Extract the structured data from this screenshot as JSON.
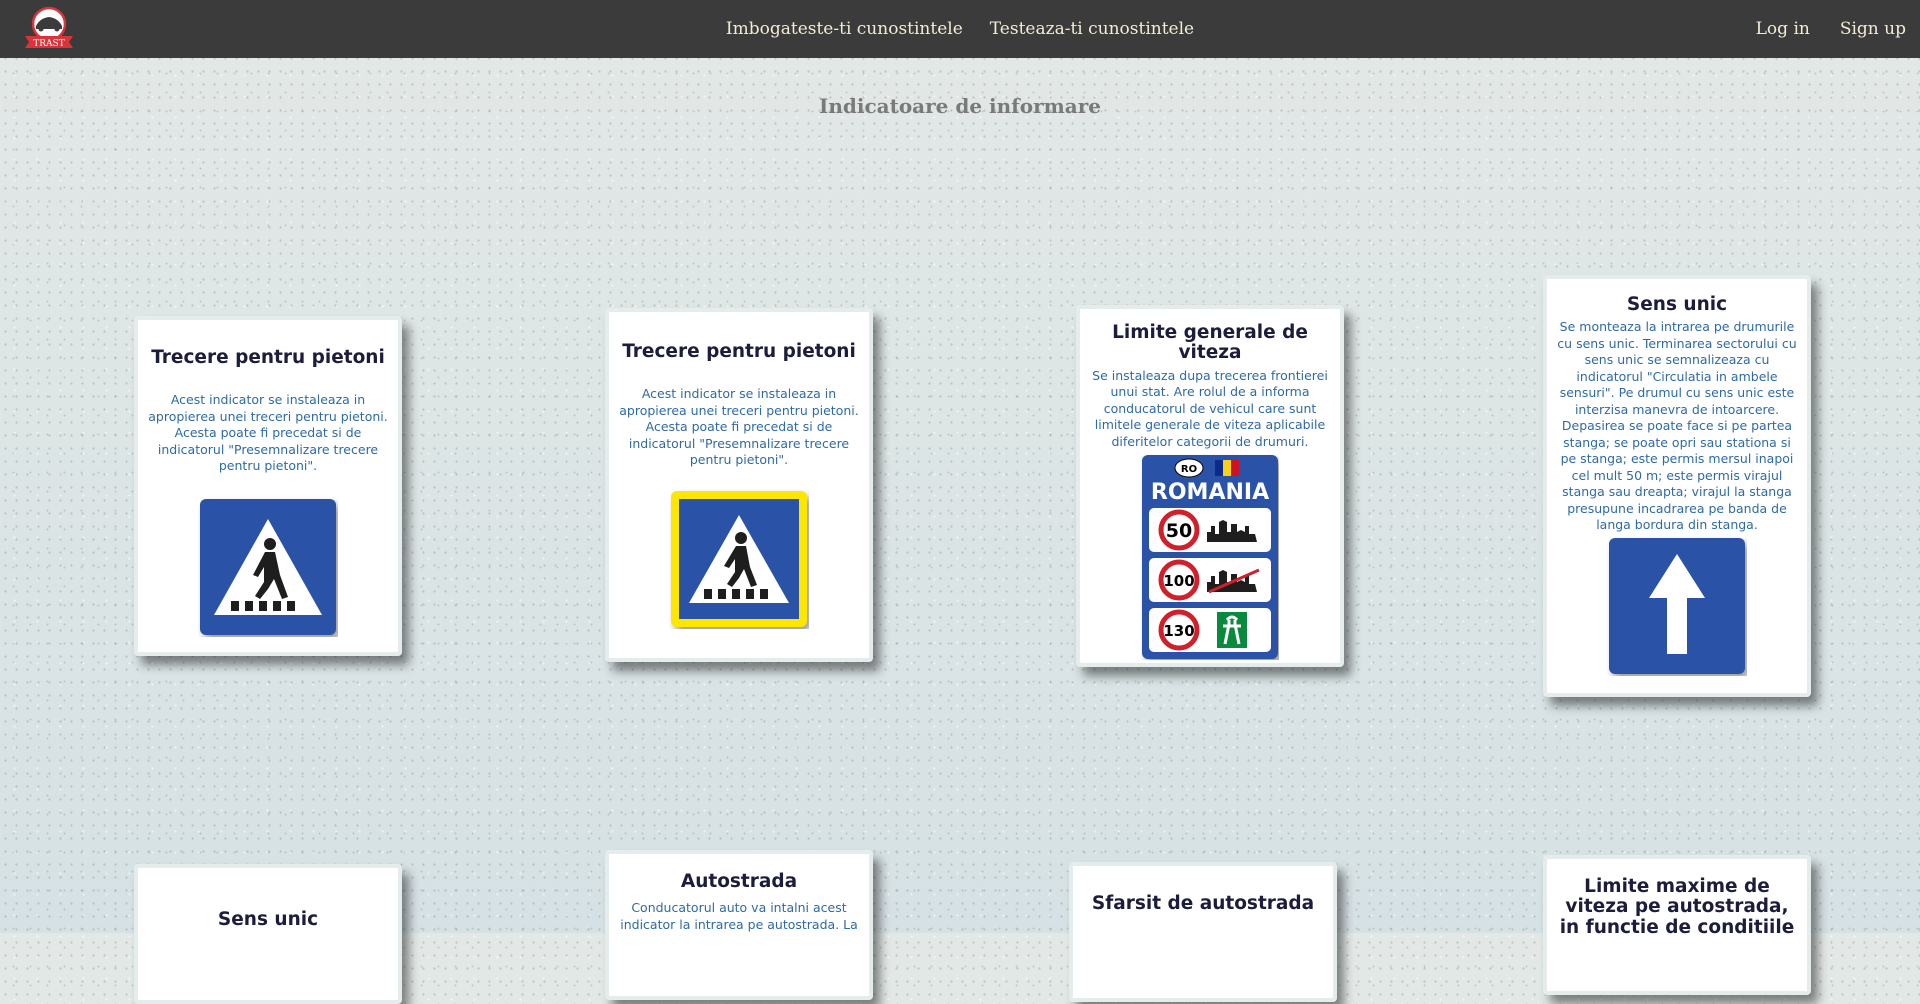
{
  "nav": {
    "logo_text": "TRAST",
    "links": [
      "Imbogateste-ti cunostintele",
      "Testeaza-ti cunostintele"
    ],
    "login": "Log in",
    "signup": "Sign up"
  },
  "page": {
    "title": "Indicatoare de informare"
  },
  "cards": [
    {
      "title": "Trecere pentru pietoni",
      "desc": "Acest indicator se instaleaza in apropierea unei treceri pentru pietoni. Acesta poate fi precedat si de indicatorul \"Presemnalizare trecere pentru pietoni\".",
      "icon": "pedestrian-crossing-sign-icon"
    },
    {
      "title": "Trecere pentru pietoni",
      "desc": "Acest indicator se instaleaza in apropierea unei treceri pentru pietoni. Acesta poate fi precedat si de indicatorul \"Presemnalizare trecere pentru pietoni\".",
      "icon": "pedestrian-crossing-yellow-border-sign-icon"
    },
    {
      "title": "Limite generale de viteza",
      "desc": "Se instaleaza dupa trecerea frontierei unui stat. Are rolul de a informa conducatorul de vehicul care sunt limitele generale de viteza aplicabile diferitelor categorii de drumuri.",
      "icon": "general-speed-limits-sign-icon",
      "sign_text": {
        "code": "RO",
        "country": "ROMANIA",
        "limits": [
          "50",
          "100",
          "130"
        ]
      }
    },
    {
      "title": "Sens unic",
      "desc": "Se monteaza la intrarea pe drumurile cu sens unic. Terminarea sectorului cu sens unic se semnalizeaza cu indicatorul \"Circulatia in ambele sensuri\". Pe drumul cu sens unic este interzisa manevra de intoarcere. Depasirea se poate face si pe partea stanga; se poate opri sau stationa si pe stanga; este permis mersul inapoi cel mult 50 m; este permis virajul stanga sau dreapta; virajul la stanga presupune incadrarea pe banda de langa bordura din stanga.",
      "icon": "one-way-arrow-sign-icon"
    },
    {
      "title": "Sens unic"
    },
    {
      "title": "Autostrada",
      "desc": "Conducatorul auto va intalni acest indicator la intrarea pe autostrada. La"
    },
    {
      "title": "Sfarsit de autostrada"
    },
    {
      "title": "Limite maxime de viteza pe autostrada, in functie de conditiile"
    }
  ],
  "colors": {
    "navbar": "#3b3b3b",
    "nav_text": "#f3ecd3",
    "sign_blue": "#2a53a8",
    "desc_blue": "#2e6aa8",
    "title_gray": "#7a7a7a"
  }
}
